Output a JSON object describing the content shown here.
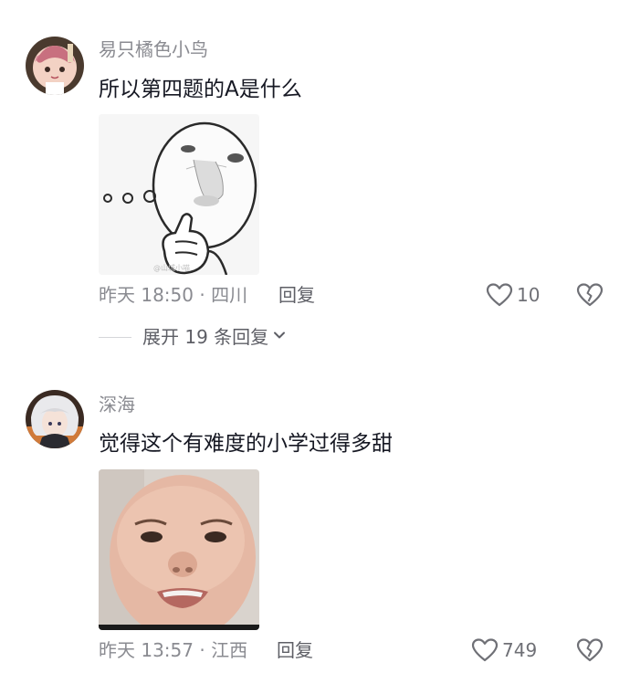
{
  "comments": [
    {
      "username": "易只橘色小鸟",
      "text": "所以第四题的A是什么",
      "meta": "昨天 18:50 · 四川",
      "reply_label": "回复",
      "like_count": "10",
      "sticker_watermark": "@山城小喵"
    },
    {
      "username": "深海",
      "text": "觉得这个有难度的小学过得多甜",
      "meta": "昨天 13:57 · 江西",
      "reply_label": "回复",
      "like_count": "749"
    }
  ],
  "expand_replies": {
    "label": "展开 19 条回复"
  },
  "colors": {
    "text_primary": "#161823",
    "text_secondary": "#8a8b91",
    "background": "#ffffff"
  },
  "icons": {
    "like": "heart-outline-icon",
    "dislike": "broken-heart-icon",
    "expand": "chevron-down-icon"
  }
}
